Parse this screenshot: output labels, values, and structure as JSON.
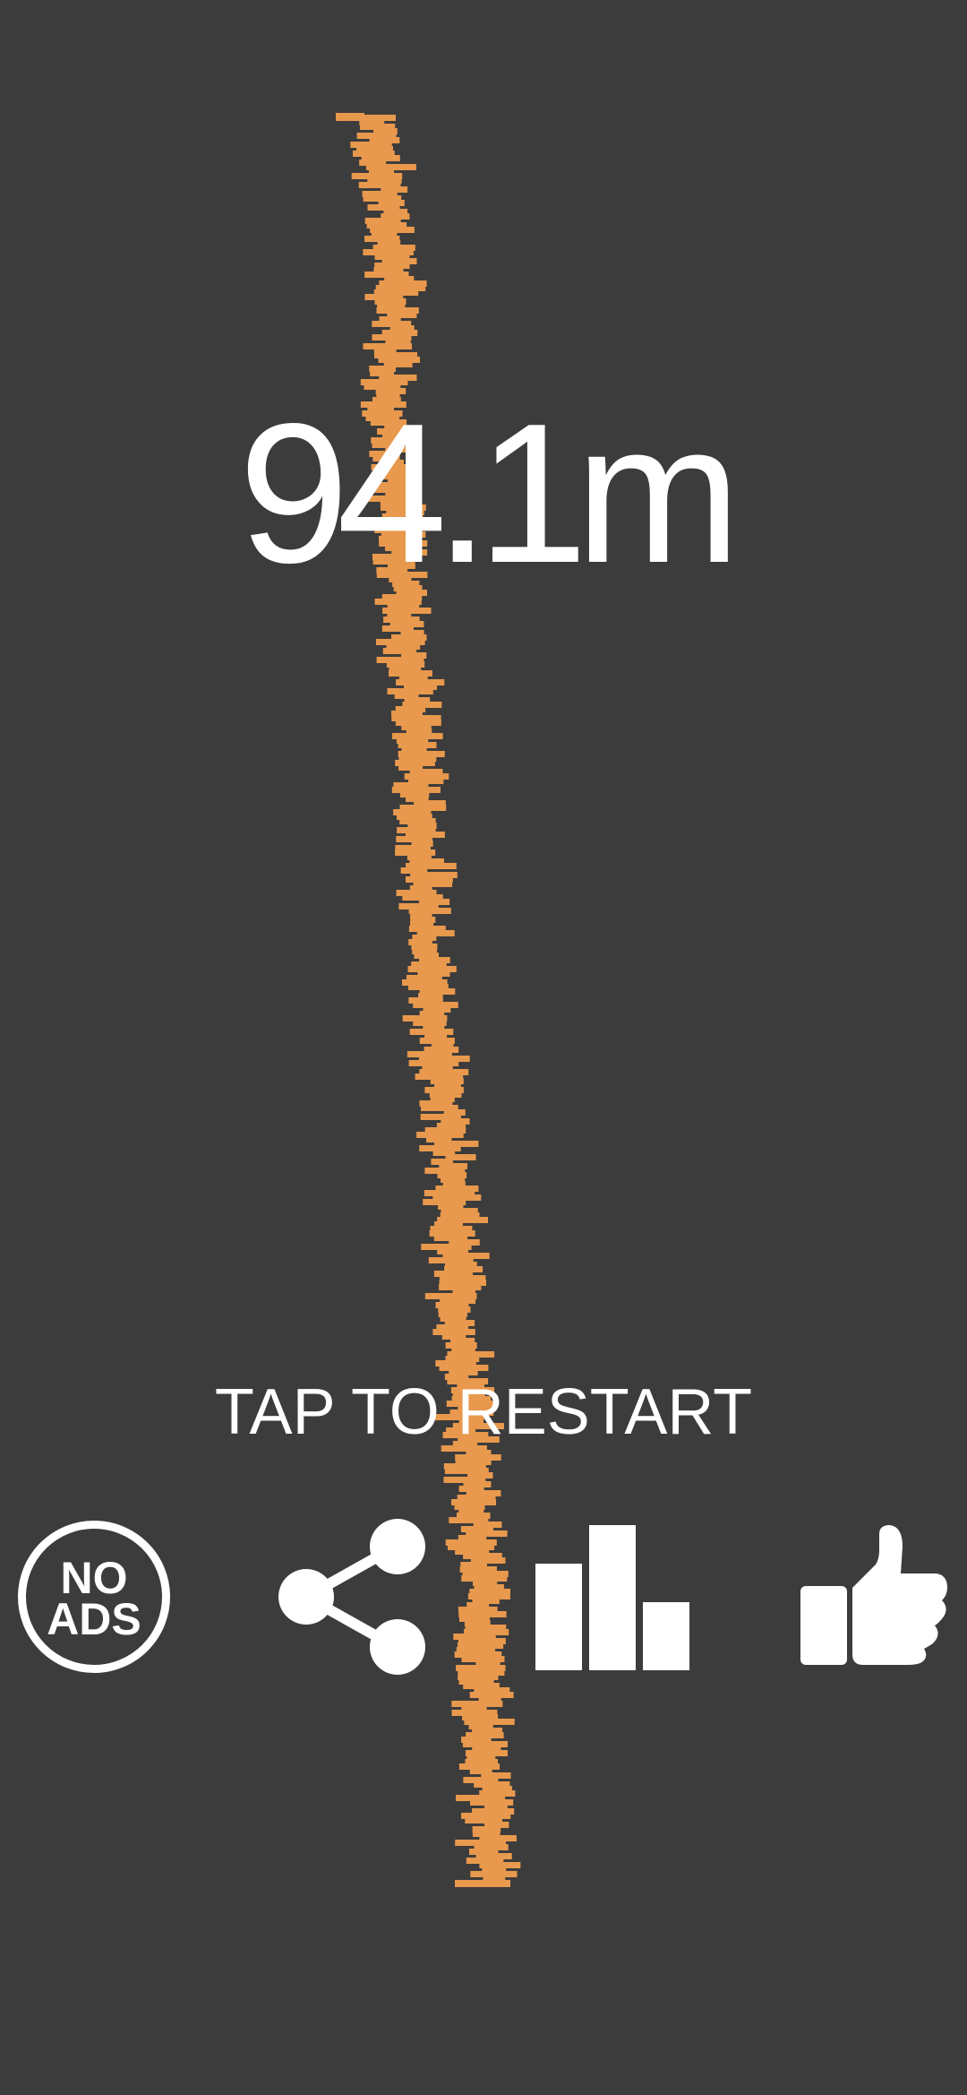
{
  "game": {
    "score": "94.1m",
    "restart_label": "TAP TO RESTART",
    "no_ads": {
      "line1": "NO",
      "line2": "ADS"
    }
  },
  "buttons": [
    {
      "id": "no-ads",
      "icon": "no-ads-icon"
    },
    {
      "id": "share",
      "icon": "share-icon"
    },
    {
      "id": "leaderboard",
      "icon": "leaderboard-icon"
    },
    {
      "id": "like",
      "icon": "thumbs-up-icon"
    }
  ],
  "colors": {
    "background": "#3d3c3c",
    "tower": "#e8994d",
    "text": "#ffffff"
  }
}
